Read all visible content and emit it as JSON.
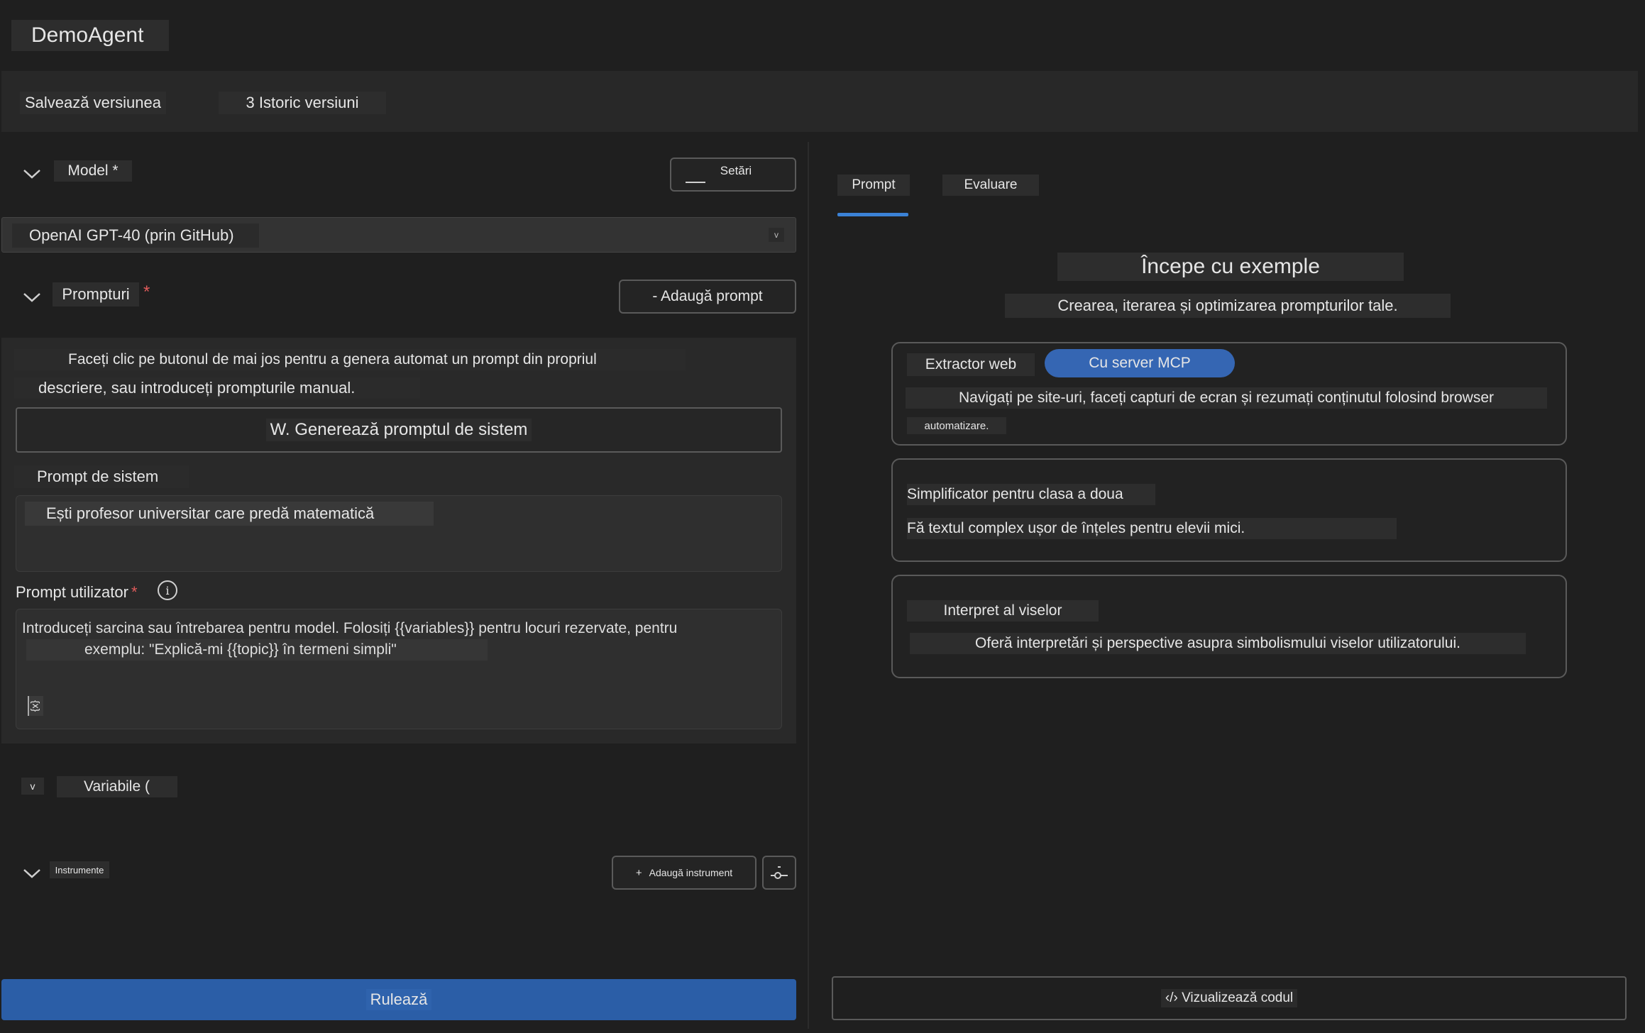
{
  "app": {
    "title": "DemoAgent"
  },
  "toolbar": {
    "save_label": "Salvează versiunea",
    "history_label": "3 Istoric versiuni"
  },
  "model_section": {
    "title": "Model *",
    "settings_label": "Setări",
    "selected_model": "OpenAI GPT-40 (prin GitHub)"
  },
  "prompts_section": {
    "title": "Prompturi",
    "required_mark": "*",
    "add_prompt_label": "- Adaugă prompt",
    "intro_line1": "Faceți clic pe butonul de mai jos pentru a genera automat un prompt din propriul",
    "intro_line2": "descriere, sau introduceți prompturile manual.",
    "generate_label": "W. Generează promptul de sistem",
    "system_label": "Prompt de sistem",
    "system_value": "Ești profesor universitar care predă matematică",
    "user_label": "Prompt utilizator",
    "user_required": "*",
    "user_placeholder_line1": "Introduceți sarcina sau întrebarea pentru model. Folosiți {{variables}} pentru locuri rezervate, pentru",
    "user_placeholder_line2": "exemplu: \"Explică-mi {{topic}} în termeni simpli\"",
    "insert_var_label": "{x}"
  },
  "variables_section": {
    "title": "Variabile (",
    "toggle": "v"
  },
  "tools_section": {
    "title": "Instrumente",
    "add_tool_label": "Adaugă instrument"
  },
  "run_label": "Rulează",
  "right_panel": {
    "tabs": [
      {
        "label": "Prompt",
        "active": true
      },
      {
        "label": "Evaluare",
        "active": false
      }
    ],
    "heading": "Începe cu exemple",
    "subheading": "Crearea, iterarea și optimizarea prompturilor tale.",
    "examples": [
      {
        "title": "Extractor web",
        "badge": "Cu server MCP",
        "desc_line1": "Navigați pe site-uri, faceți capturi de ecran și rezumați conținutul folosind browser",
        "desc_line2": "automatizare."
      },
      {
        "title": "Simplificator pentru clasa a doua",
        "desc_line1": "Fă textul complex ușor de înțeles pentru elevii mici."
      },
      {
        "title": "Interpret al viselor",
        "desc_line1": "Oferă interpretări și perspective asupra simbolismului viselor utilizatorului."
      }
    ],
    "view_code_label": "‹/› Vizualizează codul"
  },
  "colors": {
    "accent": "#2b5ea7",
    "tab_underline": "#3b82d6",
    "required": "#e05b5b",
    "badge": "#3566b3"
  }
}
